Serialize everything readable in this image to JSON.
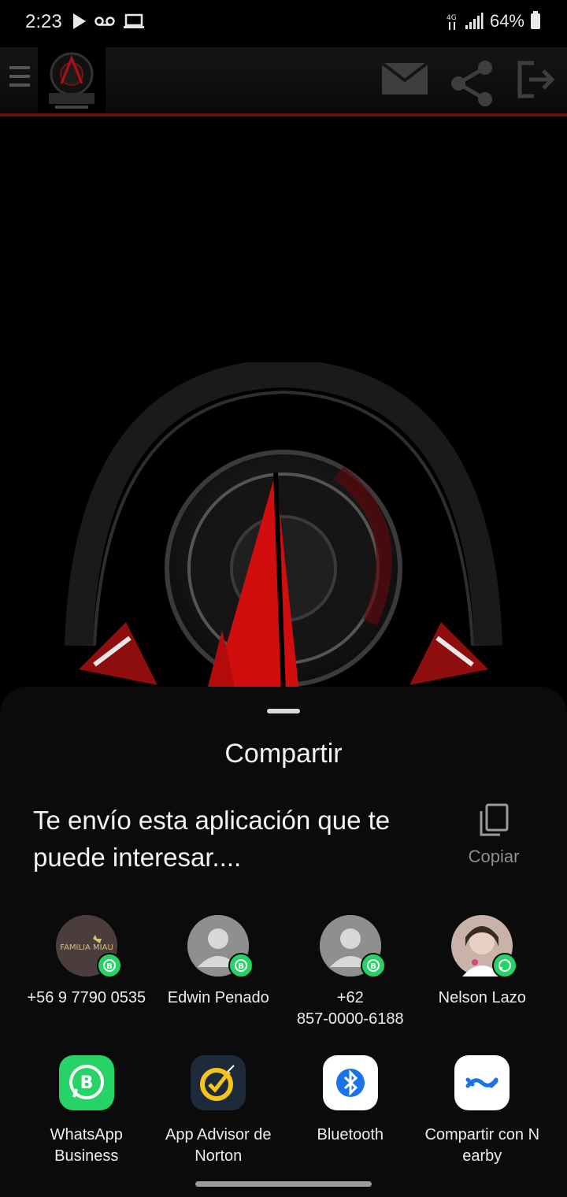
{
  "status_bar": {
    "time": "2:23",
    "battery": "64%"
  },
  "share_sheet": {
    "title": "Compartir",
    "message_line1": "Te envío esta aplicación que te",
    "message_line2": "puede interesar....",
    "copy_label": "Copiar",
    "contacts": [
      {
        "name": "+56 9 7790 0535",
        "avatar_text": "FAMILIA MIAU"
      },
      {
        "name": "Edwin Penado"
      },
      {
        "name_line1": "+62",
        "name_line2": "857-0000-6188"
      },
      {
        "name": "Nelson Lazo"
      }
    ],
    "apps": [
      {
        "line1": "WhatsApp",
        "line2": "Business",
        "color": "#25d366"
      },
      {
        "line1": "App Advisor de",
        "line2": "Norton",
        "color": "#f5c518"
      },
      {
        "line1": "Bluetooth",
        "line2": "",
        "color": "#1a73e8"
      },
      {
        "line1": "Compartir con N",
        "line2": "earby",
        "color": "#1a73e8"
      }
    ]
  }
}
